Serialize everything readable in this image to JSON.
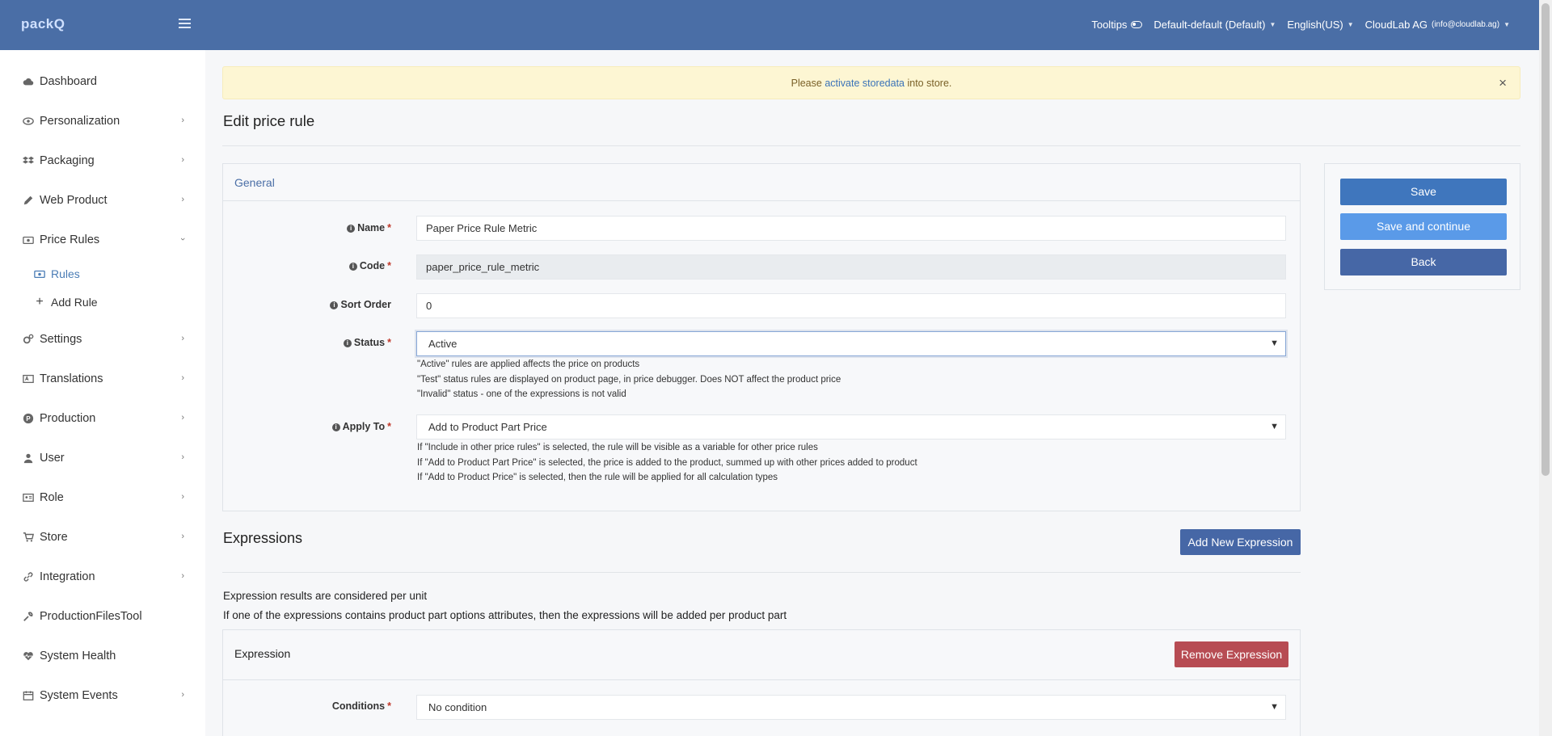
{
  "header": {
    "logo": "packQ",
    "tooltips_label": "Tooltips",
    "store_selector": "Default-default (Default)",
    "language": "English(US)",
    "account_name": "CloudLab AG",
    "account_email": "(info@cloudlab.ag)"
  },
  "sidebar": {
    "items": [
      {
        "label": "Dashboard",
        "icon": "cloud-icon"
      },
      {
        "label": "Personalization",
        "icon": "eye-icon"
      },
      {
        "label": "Packaging",
        "icon": "dropbox-icon"
      },
      {
        "label": "Web Product",
        "icon": "pencil-icon"
      },
      {
        "label": "Price Rules",
        "icon": "money-icon"
      },
      {
        "label": "Settings",
        "icon": "cogs-icon"
      },
      {
        "label": "Translations",
        "icon": "language-icon"
      },
      {
        "label": "Production",
        "icon": "production-icon"
      },
      {
        "label": "User",
        "icon": "user-icon"
      },
      {
        "label": "Role",
        "icon": "id-card-icon"
      },
      {
        "label": "Store",
        "icon": "cart-icon"
      },
      {
        "label": "Integration",
        "icon": "link-icon"
      },
      {
        "label": "ProductionFilesTool",
        "icon": "wrench-icon"
      },
      {
        "label": "System Health",
        "icon": "heartbeat-icon"
      },
      {
        "label": "System Events",
        "icon": "calendar-icon"
      }
    ],
    "sub_items": [
      {
        "label": "Rules",
        "icon": "money-icon"
      },
      {
        "label": "Add Rule",
        "icon": "plus-icon"
      }
    ]
  },
  "alert": {
    "prefix": "Please",
    "link": "activate storedata",
    "suffix": "into store.",
    "close": "×"
  },
  "page": {
    "title": "Edit price rule"
  },
  "general": {
    "title": "General",
    "name_label": "Name",
    "name_value": "Paper Price Rule Metric",
    "code_label": "Code",
    "code_value": "paper_price_rule_metric",
    "sort_label": "Sort Order",
    "sort_value": "0",
    "status_label": "Status",
    "status_value": "Active",
    "status_help": [
      "\"Active\" rules are applied affects the price on products",
      "\"Test\" status rules are displayed on product page, in price debugger. Does NOT affect the product price",
      "\"Invalid\" status - one of the expressions is not valid"
    ],
    "apply_label": "Apply To",
    "apply_value": "Add to Product Part Price",
    "apply_help": [
      "If \"Include in other price rules\" is selected, the rule will be visible as a variable for other price rules",
      "If \"Add to Product Part Price\" is selected, the price is added to the product, summed up with other prices added to product",
      "If \"Add to Product Price\" is selected, then the rule will be applied for all calculation types"
    ]
  },
  "actions": {
    "save": "Save",
    "save_continue": "Save and continue",
    "back": "Back"
  },
  "expressions": {
    "title": "Expressions",
    "add_button": "Add New Expression",
    "note1": "Expression results are considered per unit",
    "note2": "If one of the expressions contains product part options attributes, then the expressions will be added per product part",
    "expression_title": "Expression",
    "remove_button": "Remove Expression",
    "conditions_label": "Conditions",
    "conditions_value": "No condition"
  }
}
